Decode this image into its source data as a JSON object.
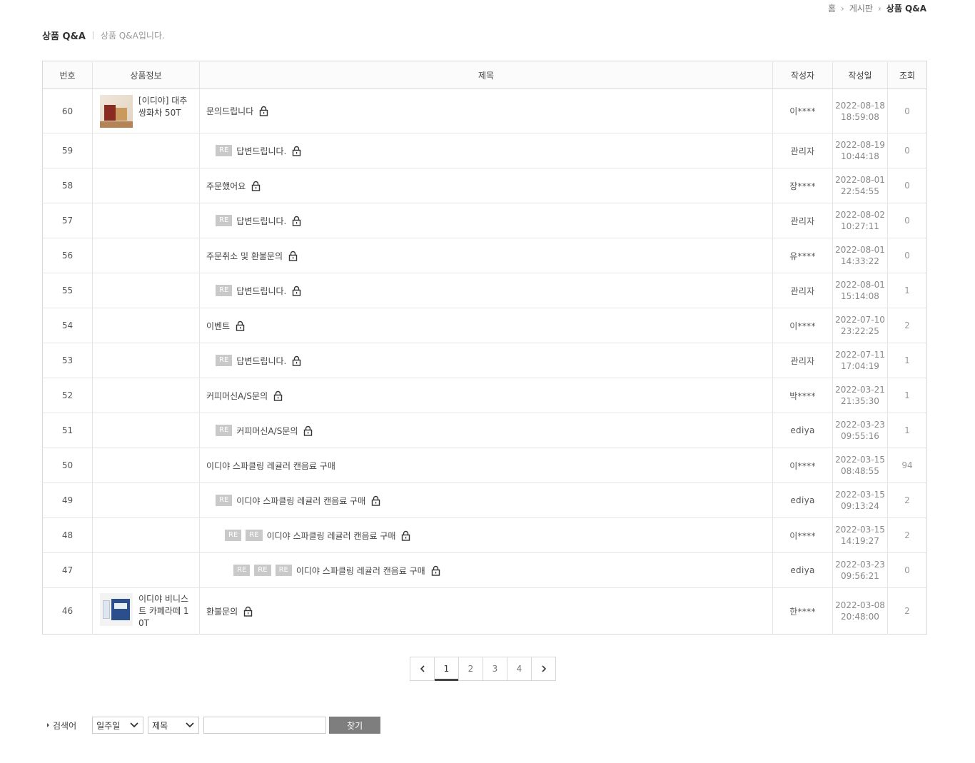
{
  "breadcrumb": [
    "홈",
    "게시판",
    "상품 Q&A"
  ],
  "page": {
    "title": "상품 Q&A",
    "description": "상품 Q&A입니다."
  },
  "table": {
    "headers": {
      "no": "번호",
      "product": "상품정보",
      "subject": "제목",
      "writer": "작성자",
      "date": "작성일",
      "hits": "조회"
    },
    "re_label": "RE",
    "rows": [
      {
        "no": "60",
        "product": "[이디야] 대추쌍화차 50T",
        "subject": "문의드립니다",
        "writer": "이****",
        "date1": "2022-08-18",
        "date2": "18:59:08",
        "hits": "0"
      },
      {
        "no": "59",
        "subject": "답변드립니다.",
        "writer": "관리자",
        "date1": "2022-08-19",
        "date2": "10:44:18",
        "hits": "0"
      },
      {
        "no": "58",
        "subject": "주문했어요",
        "writer": "장****",
        "date1": "2022-08-01",
        "date2": "22:54:55",
        "hits": "0"
      },
      {
        "no": "57",
        "subject": "답변드립니다.",
        "writer": "관리자",
        "date1": "2022-08-02",
        "date2": "10:27:11",
        "hits": "0"
      },
      {
        "no": "56",
        "subject": "주문취소 및 환불문의",
        "writer": "유****",
        "date1": "2022-08-01",
        "date2": "14:33:22",
        "hits": "0"
      },
      {
        "no": "55",
        "subject": "답변드립니다.",
        "writer": "관리자",
        "date1": "2022-08-01",
        "date2": "15:14:08",
        "hits": "1"
      },
      {
        "no": "54",
        "subject": "이벤트",
        "writer": "이****",
        "date1": "2022-07-10",
        "date2": "23:22:25",
        "hits": "2"
      },
      {
        "no": "53",
        "subject": "답변드립니다.",
        "writer": "관리자",
        "date1": "2022-07-11",
        "date2": "17:04:19",
        "hits": "1"
      },
      {
        "no": "52",
        "subject": "커피머신A/S문의",
        "writer": "박****",
        "date1": "2022-03-21",
        "date2": "21:35:30",
        "hits": "1"
      },
      {
        "no": "51",
        "subject": "커피머신A/S문의",
        "writer": "ediya",
        "date1": "2022-03-23",
        "date2": "09:55:16",
        "hits": "1"
      },
      {
        "no": "50",
        "subject": "이디야 스파클링 레귤러 캔음료 구매",
        "writer": "이****",
        "date1": "2022-03-15",
        "date2": "08:48:55",
        "hits": "94"
      },
      {
        "no": "49",
        "subject": "이디야 스파클링 레귤러 캔음료 구매",
        "writer": "ediya",
        "date1": "2022-03-15",
        "date2": "09:13:24",
        "hits": "2"
      },
      {
        "no": "48",
        "subject": "이디야 스파클링 레귤러 캔음료 구매",
        "writer": "이****",
        "date1": "2022-03-15",
        "date2": "14:19:27",
        "hits": "2"
      },
      {
        "no": "47",
        "subject": "이디야 스파클링 레귤러 캔음료 구매",
        "writer": "ediya",
        "date1": "2022-03-23",
        "date2": "09:56:21",
        "hits": "0"
      },
      {
        "no": "46",
        "product": "이디야 비니스트 카페라떼 10T",
        "subject": "환불문의",
        "writer": "한****",
        "date1": "2022-03-08",
        "date2": "20:48:00",
        "hits": "2"
      }
    ]
  },
  "pagination": {
    "pages": [
      "1",
      "2",
      "3",
      "4"
    ],
    "current": "1",
    "prev_icon": "chevron-left-icon",
    "next_icon": "chevron-right-icon"
  },
  "search": {
    "label": "검색어",
    "period": "일주일",
    "field": "제목",
    "query": "",
    "button": "찾기"
  }
}
